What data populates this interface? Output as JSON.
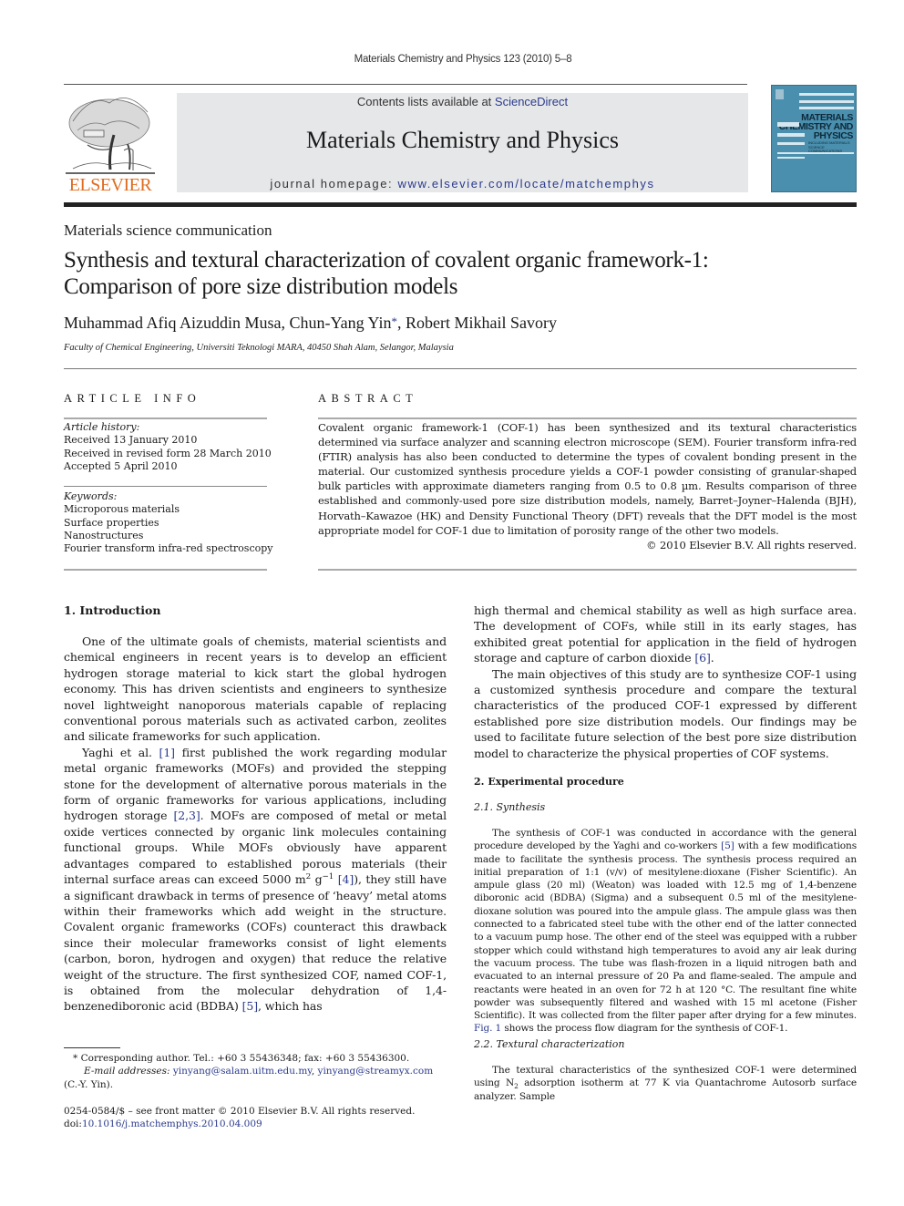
{
  "running_head": "Materials Chemistry and Physics 123 (2010) 5–8",
  "header": {
    "publisher_logo_text": "ELSEVIER",
    "contents_prefix": "Contents lists available at ",
    "contents_link": "ScienceDirect",
    "journal_title": "Materials Chemistry and Physics",
    "homepage_prefix": "journal homepage: ",
    "homepage_link": "www.elsevier.com/locate/matchemphys",
    "cover": {
      "line1": "MATERIALS",
      "line2": "CHEMISTRY AND",
      "line3": "PHYSICS",
      "subtitle": "INCLUDING MATERIALS SCIENCE COMMUNICATIONS",
      "color": "#4a8fad"
    },
    "logo_color": "#e06c1e",
    "link_color": "#2a3a8c"
  },
  "article": {
    "section_type": "Materials science communication",
    "title_line1": "Synthesis and textural characterization of covalent organic framework-1:",
    "title_line2": "Comparison of pore size distribution models",
    "authors": {
      "author1": "Muhammad Afiq Aizuddin Musa, ",
      "author2": "Chun-Yang Yin",
      "corresponding_mark": "*",
      "author3": ", Robert Mikhail Savory"
    },
    "affiliation": "Faculty of Chemical Engineering, Universiti Teknologi MARA, 40450 Shah Alam, Selangor, Malaysia"
  },
  "article_info": {
    "heading": "ARTICLE INFO",
    "history_label": "Article history:",
    "history": [
      "Received 13 January 2010",
      "Received in revised form 28 March 2010",
      "Accepted 5 April 2010"
    ],
    "keywords_label": "Keywords:",
    "keywords": [
      "Microporous materials",
      "Surface properties",
      "Nanostructures",
      "Fourier transform infra-red spectroscopy"
    ]
  },
  "abstract": {
    "heading": "ABSTRACT",
    "text": "Covalent organic framework-1 (COF-1) has been synthesized and its textural characteristics determined via surface analyzer and scanning electron microscope (SEM). Fourier transform infra-red (FTIR) analysis has also been conducted to determine the types of covalent bonding present in the material. Our customized synthesis procedure yields a COF-1 powder consisting of granular-shaped bulk particles with approximate diameters ranging from 0.5 to 0.8 µm. Results comparison of three established and commonly-used pore size distribution models, namely, Barret–Joyner–Halenda (BJH), Horvath–Kawazoe (HK) and Density Functional Theory (DFT) reveals that the DFT model is the most appropriate model for COF-1 due to limitation of porosity range of the other two models.",
    "copyright": "© 2010 Elsevier B.V. All rights reserved."
  },
  "body": {
    "section1_heading": "1.  Introduction",
    "intro_p1": "One of the ultimate goals of chemists, material scientists and chemical engineers in recent years is to develop an efficient hydrogen storage material to kick start the global hydrogen economy. This has driven scientists and engineers to synthesize novel lightweight nanoporous materials capable of replacing conventional porous materials such as activated carbon, zeolites and silicate frameworks for such application.",
    "intro_p2": {
      "a": "Yaghi et al. ",
      "ref1": "[1]",
      "b": " first published the work regarding modular metal organic frameworks (MOFs) and provided the stepping stone for the development of alternative porous materials in the form of organic frameworks for various applications, including hydrogen storage ",
      "ref2": "[2,3]",
      "c": ". MOFs are composed of metal or metal oxide vertices connected by organic link molecules containing functional groups. While MOFs obviously have apparent advantages compared to established porous materials (their internal surface areas can exceed 5000 m",
      "sup1": "2",
      "d": " g",
      "sup2": "−1",
      "e": " ",
      "ref3": "[4]",
      "f": "), they still have a significant drawback in terms of presence of ‘heavy’ metal atoms within their frameworks which add weight in the structure. Covalent organic frameworks (COFs) counteract this drawback since their molecular frameworks consist of light elements (carbon, boron, hydrogen and oxygen) that reduce the relative weight of the structure. The first synthesized COF, named COF-1, is obtained from the molecular dehydration of 1,4-benzenediboronic acid (BDBA) ",
      "ref4": "[5]",
      "g": ", which has"
    },
    "right_p1": {
      "a": "high thermal and chemical stability as well as high surface area. The development of COFs, while still in its early stages, has exhibited great potential for application in the field of hydrogen storage and capture of carbon dioxide ",
      "ref": "[6]",
      "b": "."
    },
    "right_p2": "The main objectives of this study are to synthesize COF-1 using a customized synthesis procedure and compare the textural characteristics of the produced COF-1 expressed by different established pore size distribution models. Our findings may be used to facilitate future selection of the best pore size distribution model to characterize the physical properties of COF systems.",
    "section2_heading": "2.  Experimental procedure",
    "sub21_heading": "2.1.  Synthesis",
    "synthesis_p": {
      "a": "The synthesis of COF-1 was conducted in accordance with the general procedure developed by the Yaghi and co-workers ",
      "ref": "[5]",
      "b": " with a few modifications made to facilitate the synthesis process. The synthesis process required an initial preparation of 1:1 (v/v) of mesitylene:dioxane (Fisher Scientific). An ampule glass (20 ml) (Weaton) was loaded with 12.5 mg of 1,4-benzene diboronic acid (BDBA) (Sigma) and a subsequent 0.5 ml of the mesitylene-dioxane solution was poured into the ampule glass. The ampule glass was then connected to a fabricated steel tube with the other end of the latter connected to a vacuum pump hose. The other end of the steel was equipped with a rubber stopper which could withstand high temperatures to avoid any air leak during the vacuum process. The tube was flash-frozen in a liquid nitrogen bath and evacuated to an internal pressure of 20 Pa and flame-sealed. The ampule and reactants were heated in an oven for 72 h at 120 °C. The resultant fine white powder was subsequently filtered and washed with 15 ml acetone (Fisher Scientific). It was collected from the filter paper after drying for a few minutes. ",
      "fig_ref": "Fig. 1",
      "c": " shows the process flow diagram for the synthesis of COF-1."
    },
    "sub22_heading": "2.2.  Textural characterization",
    "textural_p": {
      "a": "The textural characteristics of the synthesized COF-1 were determined using N",
      "sub": "2",
      "b": " adsorption isotherm at 77 K via Quantachrome Autosorb surface analyzer. Sample"
    }
  },
  "footnote": {
    "mark": "*",
    "corresponding": " Corresponding author. Tel.: +60 3 55436348; fax: +60 3 55436300.",
    "email_label": "E-mail addresses:",
    "email1": "yinyang@salam.uitm.edu.my",
    "sep": ", ",
    "email2": "yinyang@streamyx.com",
    "owner": "(C.-Y. Yin)."
  },
  "front_matter": {
    "issn_line": "0254-0584/$ – see front matter © 2010 Elsevier B.V. All rights reserved.",
    "doi_prefix": "doi:",
    "doi": "10.1016/j.matchemphys.2010.04.009"
  }
}
